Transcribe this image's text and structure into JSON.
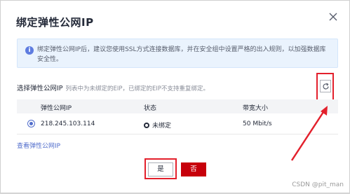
{
  "dialog": {
    "title": "绑定弹性公网IP",
    "notice": "绑定弹性公网IP后，建议您使用SSL方式连接数据库，并在安全组中设置严格的出入规则，以加强数据库安全性。",
    "select_label": "选择弹性公网IP",
    "select_hint": "列表中为未绑定的EIP，已绑定的EIP不支持重复绑定。",
    "table": {
      "headers": [
        "弹性公网IP",
        "状态",
        "带宽大小"
      ],
      "rows": [
        {
          "selected": true,
          "ip": "218.245.103.114",
          "status": "未绑定",
          "bandwidth": "50 Mbit/s"
        }
      ]
    },
    "view_link": "查看弹性公网IP",
    "yes_label": "是",
    "no_label": "否"
  },
  "watermark": "CSDN @pit_man",
  "colors": {
    "accent": "#526ecc",
    "danger": "#c7000b",
    "annotation": "#e3202c",
    "notice_bg": "#eaf3fd"
  },
  "icons": [
    "close-icon",
    "info-icon",
    "refresh-icon",
    "radio-selected-icon",
    "unbound-status-icon"
  ]
}
